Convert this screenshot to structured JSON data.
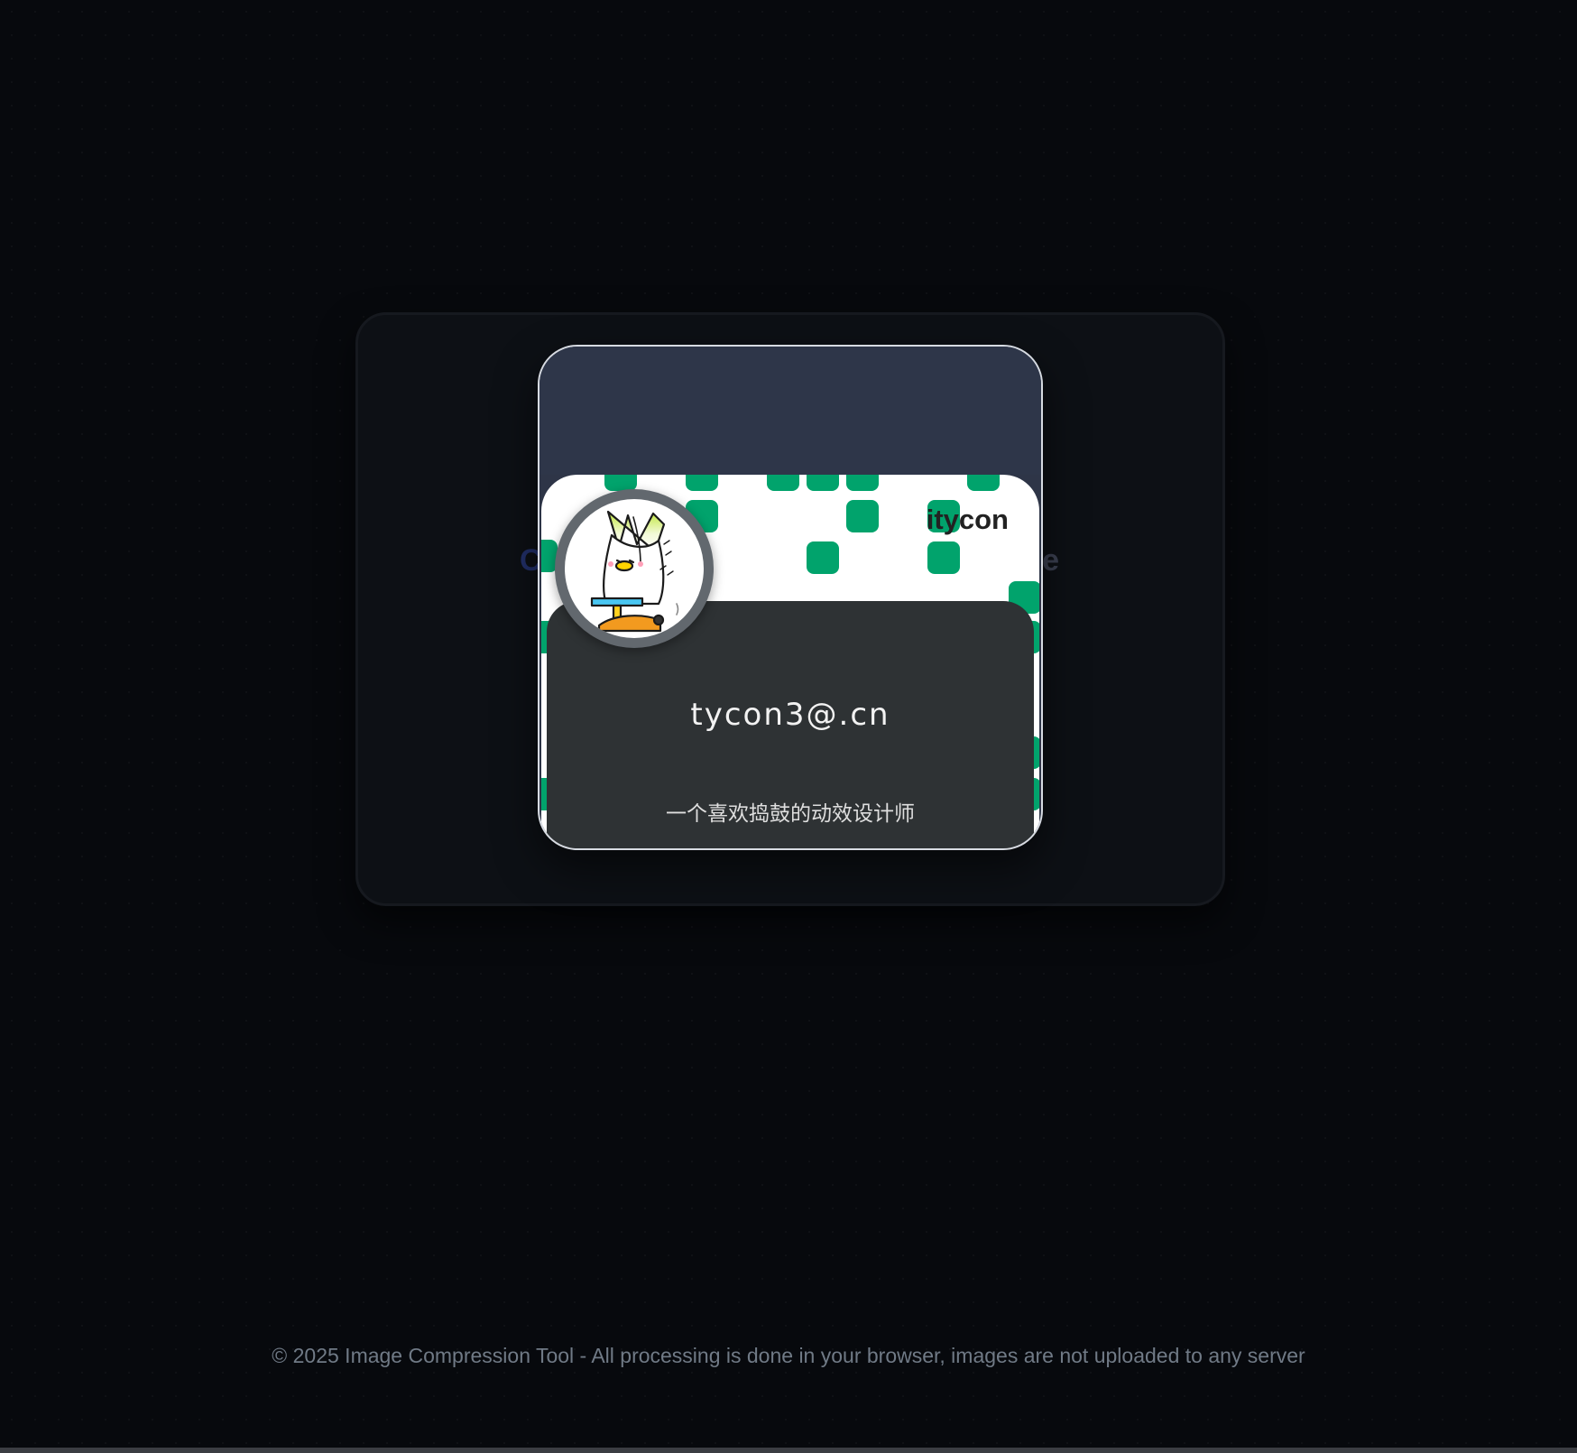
{
  "background": {
    "page_color": "#07090d",
    "panel_color": "#0d1015",
    "card_header_color": "#2e3649",
    "info_panel_color": "#2e3234",
    "pattern_accent": "#01a36c"
  },
  "underlying_heading": {
    "left_fragment": "C",
    "right_fragment": "e"
  },
  "profile_card": {
    "username": "itycon",
    "email": "tycon3@.cn",
    "bio": "一个喜欢捣鼓的动效设计师",
    "avatar_icon": "cartoon-leek-character-icon"
  },
  "footer": {
    "text": "© 2025 Image Compression Tool - All processing is done in your browser, images are not uploaded to any server"
  }
}
